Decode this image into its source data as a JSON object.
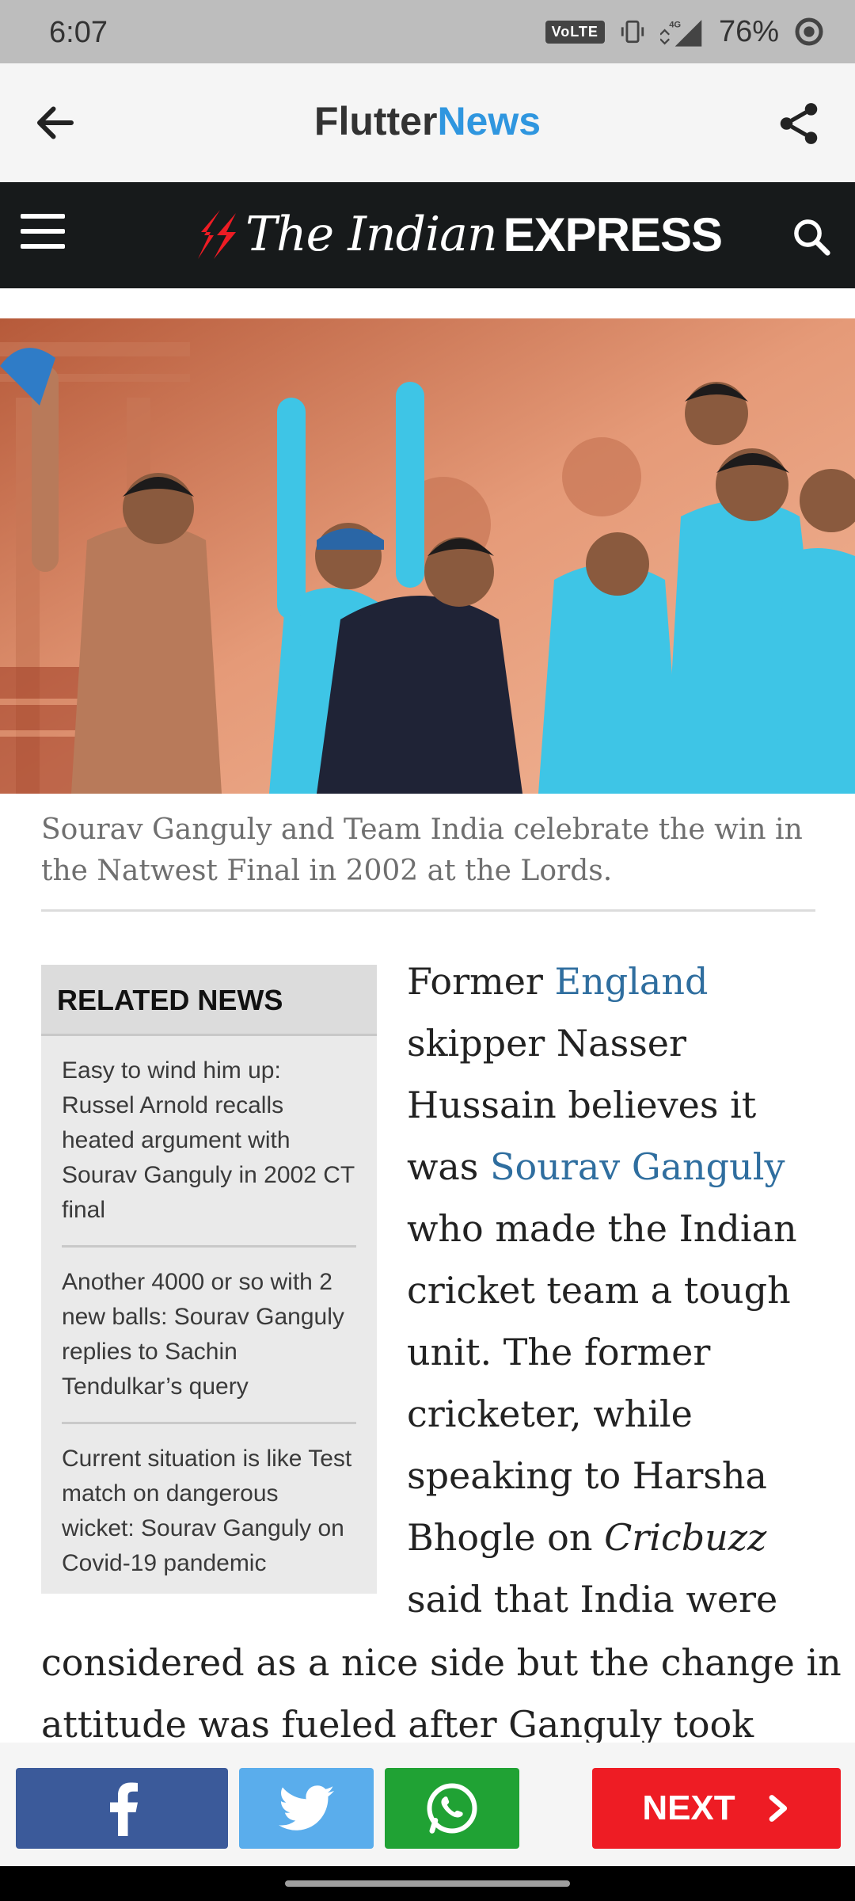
{
  "status_bar": {
    "time": "6:07",
    "volte": "VoLTE",
    "network": "4G",
    "battery": "76%"
  },
  "app_bar": {
    "title_part1": "Flutter",
    "title_part2": "News",
    "accent": "#2f96df"
  },
  "masthead": {
    "brand_part1": "The Indian",
    "brand_part2": "EXPRESS",
    "brand_color": "#ee1c24"
  },
  "hero": {
    "caption": "Sourav Ganguly and Team India celebrate the win in the Natwest Final in 2002 at the Lords."
  },
  "related": {
    "heading": "RELATED NEWS",
    "items": [
      {
        "title": "Easy to wind him up: Russel Arnold recalls heated argument with Sourav Ganguly in 2002 CT final"
      },
      {
        "title": "Another 4000 or so with 2 new balls: Sourav Ganguly replies to Sachin Tendulkar’s query"
      },
      {
        "title": "Current situation is like Test match on dangerous wicket: Sourav Ganguly on Covid-19 pandemic"
      }
    ]
  },
  "article": {
    "t1": "Former",
    "link1": "England",
    "t2": "skipper Nasser Hussain believes it was",
    "link2": "Sourav Ganguly",
    "t3": "who made the Indian cricket team a tough unit. The former cricketer, while speaking to Harsha Bhogle on",
    "italic": "Cricbuzz",
    "t4": "said that India were",
    "line_full_1": "considered as a nice side but the change in",
    "line_full_2": "attitude was fueled after Ganguly took"
  },
  "share_bar": {
    "next_label": "NEXT",
    "facebook_color": "#3b5a9a",
    "twitter_color": "#5aadec",
    "whatsapp_color": "#20a234",
    "next_color": "#ee1c24"
  }
}
